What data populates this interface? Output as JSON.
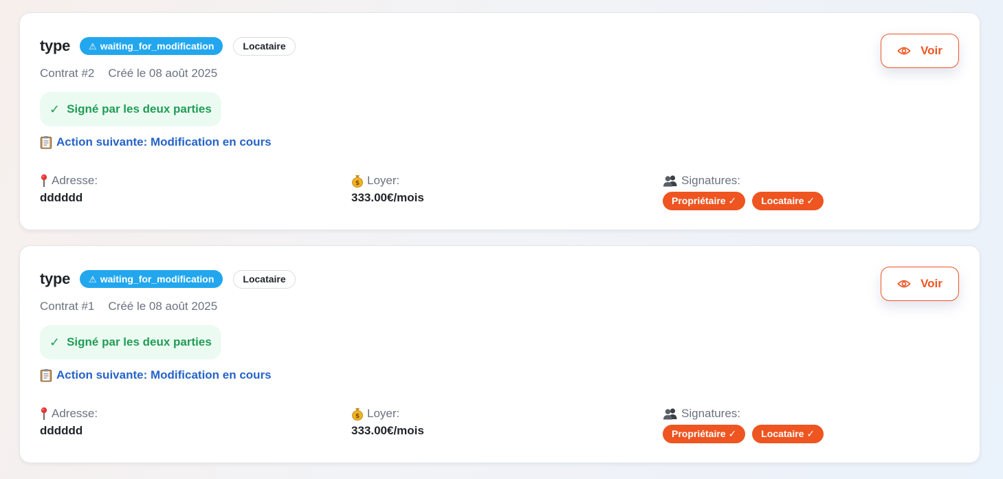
{
  "contracts": [
    {
      "title": "type",
      "status_label": "waiting_for_modification",
      "role_label": "Locataire",
      "contract_number": "Contrat #2",
      "created_label": "Créé le 08 août 2025",
      "signed_label": "Signé par les deux parties",
      "next_action_label": "Action suivante: Modification en cours",
      "address_label": "Adresse:",
      "address_value": "dddddd",
      "rent_label": "Loyer:",
      "rent_value": "333.00€/mois",
      "signatures_label": "Signatures:",
      "signatures": [
        "Propriétaire ✓",
        "Locataire ✓"
      ],
      "view_label": "Voir"
    },
    {
      "title": "type",
      "status_label": "waiting_for_modification",
      "role_label": "Locataire",
      "contract_number": "Contrat #1",
      "created_label": "Créé le 08 août 2025",
      "signed_label": "Signé par les deux parties",
      "next_action_label": "Action suivante: Modification en cours",
      "address_label": "Adresse:",
      "address_value": "dddddd",
      "rent_label": "Loyer:",
      "rent_value": "333.00€/mois",
      "signatures_label": "Signatures:",
      "signatures": [
        "Propriétaire ✓",
        "Locataire ✓"
      ],
      "view_label": "Voir"
    }
  ],
  "icons": {
    "status": "warning-icon",
    "signed": "check-icon",
    "next_action": "clipboard-icon",
    "address": "pin-icon",
    "rent": "money-bag-icon",
    "signatures": "people-icon",
    "view": "eye-icon"
  },
  "colors": {
    "accent": "#ee5521",
    "status_badge": "#22a7ee",
    "signed_text": "#1f9d55",
    "signed_bg": "#ecfbf2",
    "link": "#2563c9"
  }
}
